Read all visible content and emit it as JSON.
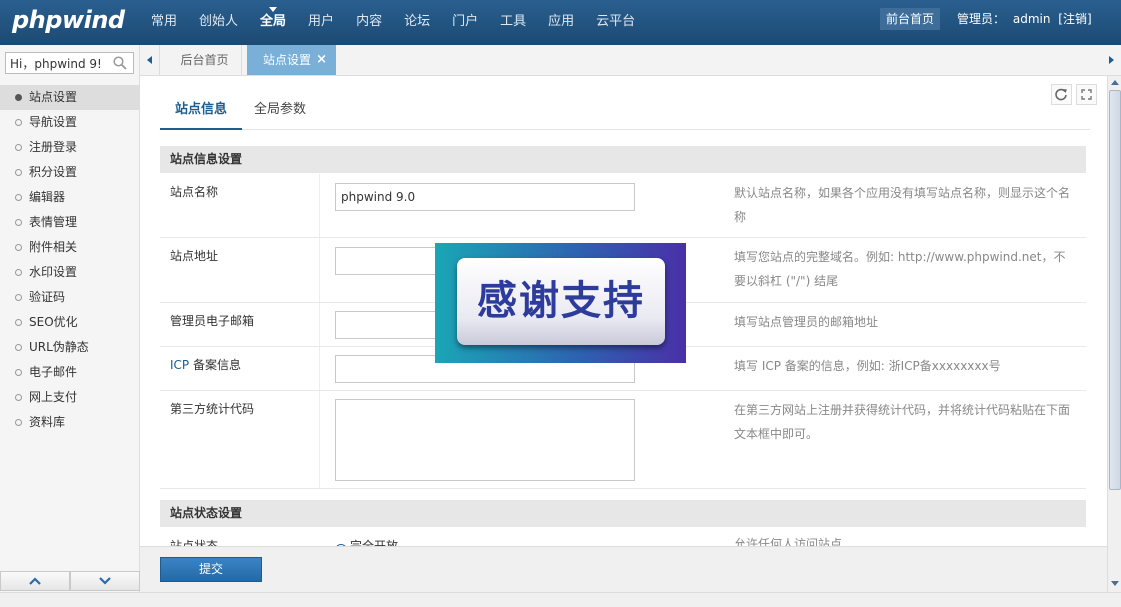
{
  "header": {
    "logo": "phpwind",
    "nav": [
      "常用",
      "创始人",
      "全局",
      "用户",
      "内容",
      "论坛",
      "门户",
      "工具",
      "应用",
      "云平台"
    ],
    "active_nav": "全局",
    "frontpage_label": "前台首页",
    "admin_label": "管理员：",
    "admin_name": "admin",
    "logout_label": "[注销]"
  },
  "sidebar": {
    "search_value": "Hi，phpwind 9!",
    "items": [
      {
        "label": "站点设置",
        "active": true
      },
      {
        "label": "导航设置"
      },
      {
        "label": "注册登录"
      },
      {
        "label": "积分设置"
      },
      {
        "label": "编辑器"
      },
      {
        "label": "表情管理"
      },
      {
        "label": "附件相关"
      },
      {
        "label": "水印设置"
      },
      {
        "label": "验证码"
      },
      {
        "label": "SEO优化"
      },
      {
        "label": "URL伪静态"
      },
      {
        "label": "电子邮件"
      },
      {
        "label": "网上支付"
      },
      {
        "label": "资料库"
      }
    ]
  },
  "tabs": {
    "home": "后台首页",
    "current": "站点设置",
    "close_glyph": "×"
  },
  "subtabs": {
    "info": "站点信息",
    "global": "全局参数"
  },
  "section1": {
    "title": "站点信息设置",
    "rows": [
      {
        "label": "站点名称",
        "value": "phpwind 9.0",
        "help": "默认站点名称，如果各个应用没有填写站点名称，则显示这个名称"
      },
      {
        "label": "站点地址",
        "value": "",
        "help": "填写您站点的完整域名。例如: http://www.phpwind.net，不要以斜杠 (\"/\") 结尾"
      },
      {
        "label": "管理员电子邮箱",
        "value": "",
        "help": "填写站点管理员的邮箱地址"
      },
      {
        "label_prefix": "ICP",
        "label": " 备案信息",
        "value": "",
        "help": "填写 ICP 备案的信息，例如: 浙ICP备xxxxxxxx号"
      },
      {
        "label": "第三方统计代码",
        "value": "",
        "help": "在第三方网站上注册并获得统计代码，并将统计代码粘贴在下面文本框中即可。"
      }
    ]
  },
  "section2": {
    "title": "站点状态设置",
    "partial_label": "站点状态",
    "partial_option": "完全开放",
    "partial_help": "允许任何人访问站点"
  },
  "actions": {
    "submit": "提交"
  },
  "overlay": {
    "text": "感谢支持"
  },
  "colors": {
    "topbar": "#1f4e7a",
    "accent": "#1a5e93",
    "active_tab": "#7ab0d8"
  }
}
